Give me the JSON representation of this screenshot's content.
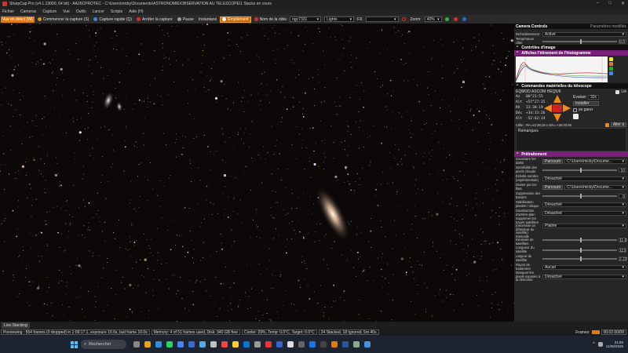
{
  "titlebar": {
    "title": "SharpCap Pro (v4.1.13000, 64 bit) - AA26CPROTEC - C:\\Users\\micky\\Documents\\ASTRONOMIE\\OBSERVATION AU TELESCOPE\\1 Stacks en cours"
  },
  "menu": [
    "Fichier",
    "Cameras",
    "Capture",
    "Vue",
    "Outils",
    "Lancer",
    "Scripts",
    "Aide (H)"
  ],
  "toolbar": {
    "live_view": "Vue en direct (W)",
    "start_capture": "Commencer la capture (S)",
    "quick_capture": "Capture rapide (Q)",
    "stop_capture": "Arrêter la capture",
    "pause": "Pause",
    "snapshot": "Instantané",
    "stacking": "Empilement",
    "target_label": "Nom de la cible",
    "target_value": "ngc7331",
    "frame_type": "Lights",
    "fx_label": "FX",
    "zoom_label": "Zoom:",
    "zoom_value": "40%"
  },
  "panel": {
    "camera_controls": "Camera Controls",
    "restore_params": "Paramètres modifiés",
    "cooling_label": "Refroidissement",
    "cooling_value": "Activé",
    "temp_label": "Température cible",
    "temp_value": "0.0",
    "image_controls": "Contrôles d'image",
    "histogram_title": "Affichez l'étirement de l'histogramme",
    "telescope_title": "Commandes matérielles du télescope",
    "mount_name": "EQMOD ASCOM HEQ5/6",
    "mount_connected": "Lié",
    "coords": [
      {
        "k": "Az",
        "v": "80°21:55"
      },
      {
        "k": "Alt",
        "v": "+57°27:35"
      },
      {
        "k": "RA",
        "v": "22:38:19"
      },
      {
        "k": "Déc",
        "v": "+34:33:26"
      },
      {
        "k": "Alt",
        "v": "-52:62:14"
      }
    ],
    "guide_label": "Evaluer",
    "guide_rate": "32x",
    "install_label": "Installer",
    "park_label": "se garer",
    "target_coords": "Cible : RA=22:38:19.1 Déc=+34:33:26",
    "goto_button": "Aller à",
    "remarks": "Remarques",
    "pretreatment": "Prétraitement",
    "rows": [
      {
        "label": "Soustraire les darks",
        "button": "Parcourir",
        "value": "C:\\Users\\micky\\Docume..."
      },
      {
        "label": "Sensibilité des pixels chauds",
        "num": "10"
      },
      {
        "label": "Échelle sombre (expérimentale)",
        "select": "Désactivé"
      },
      {
        "label": "Diviser par les flats",
        "button": "Parcourir",
        "value": "C:\\Users\\micky\\Docume..."
      },
      {
        "label": "Suppression des bandes",
        "num": "0"
      },
      {
        "label": "Stabilisation planète / disque",
        "select": "Désactivé"
      },
      {
        "label": "Soustraction d'arrière-plan",
        "select": "Désactivé"
      },
      {
        "label": "Supprimer les traces satellites (nécessite un détecteur du satellite)",
        "select": "Platine"
      },
      {
        "label": "Intervalle minimale de satellites",
        "num": "11.0"
      },
      {
        "label": "Longueur du satellite",
        "num": "113"
      },
      {
        "label": "Largeur du satellite",
        "num": "2.22"
      },
      {
        "label": "Rayon de traitement",
        "select": "Aucun"
      },
      {
        "label": "Masquer les pixels exposés à la détection",
        "select": "Désactivé"
      }
    ]
  },
  "livebar": {
    "tab": "Live Stacking"
  },
  "status": {
    "preview": "Previewing : 554 frames (0 dropped) in 1:09:17.1, exposure 10.0s, last frame 10.0s",
    "memory": "Memory: 4 of 51 frames used, Disk: 340 GB free",
    "cooler": "Cooler: 29%, Temp: 0.0°C, Target: 0.0°C",
    "stack": "24 Stacked, 18 Ignored, 5m 40s",
    "frames_label": "Frames:",
    "elapsed": "00:02:00/08"
  },
  "taskbar": {
    "search": "Rechercher",
    "time": "21:55",
    "date": "11/08/2026"
  }
}
